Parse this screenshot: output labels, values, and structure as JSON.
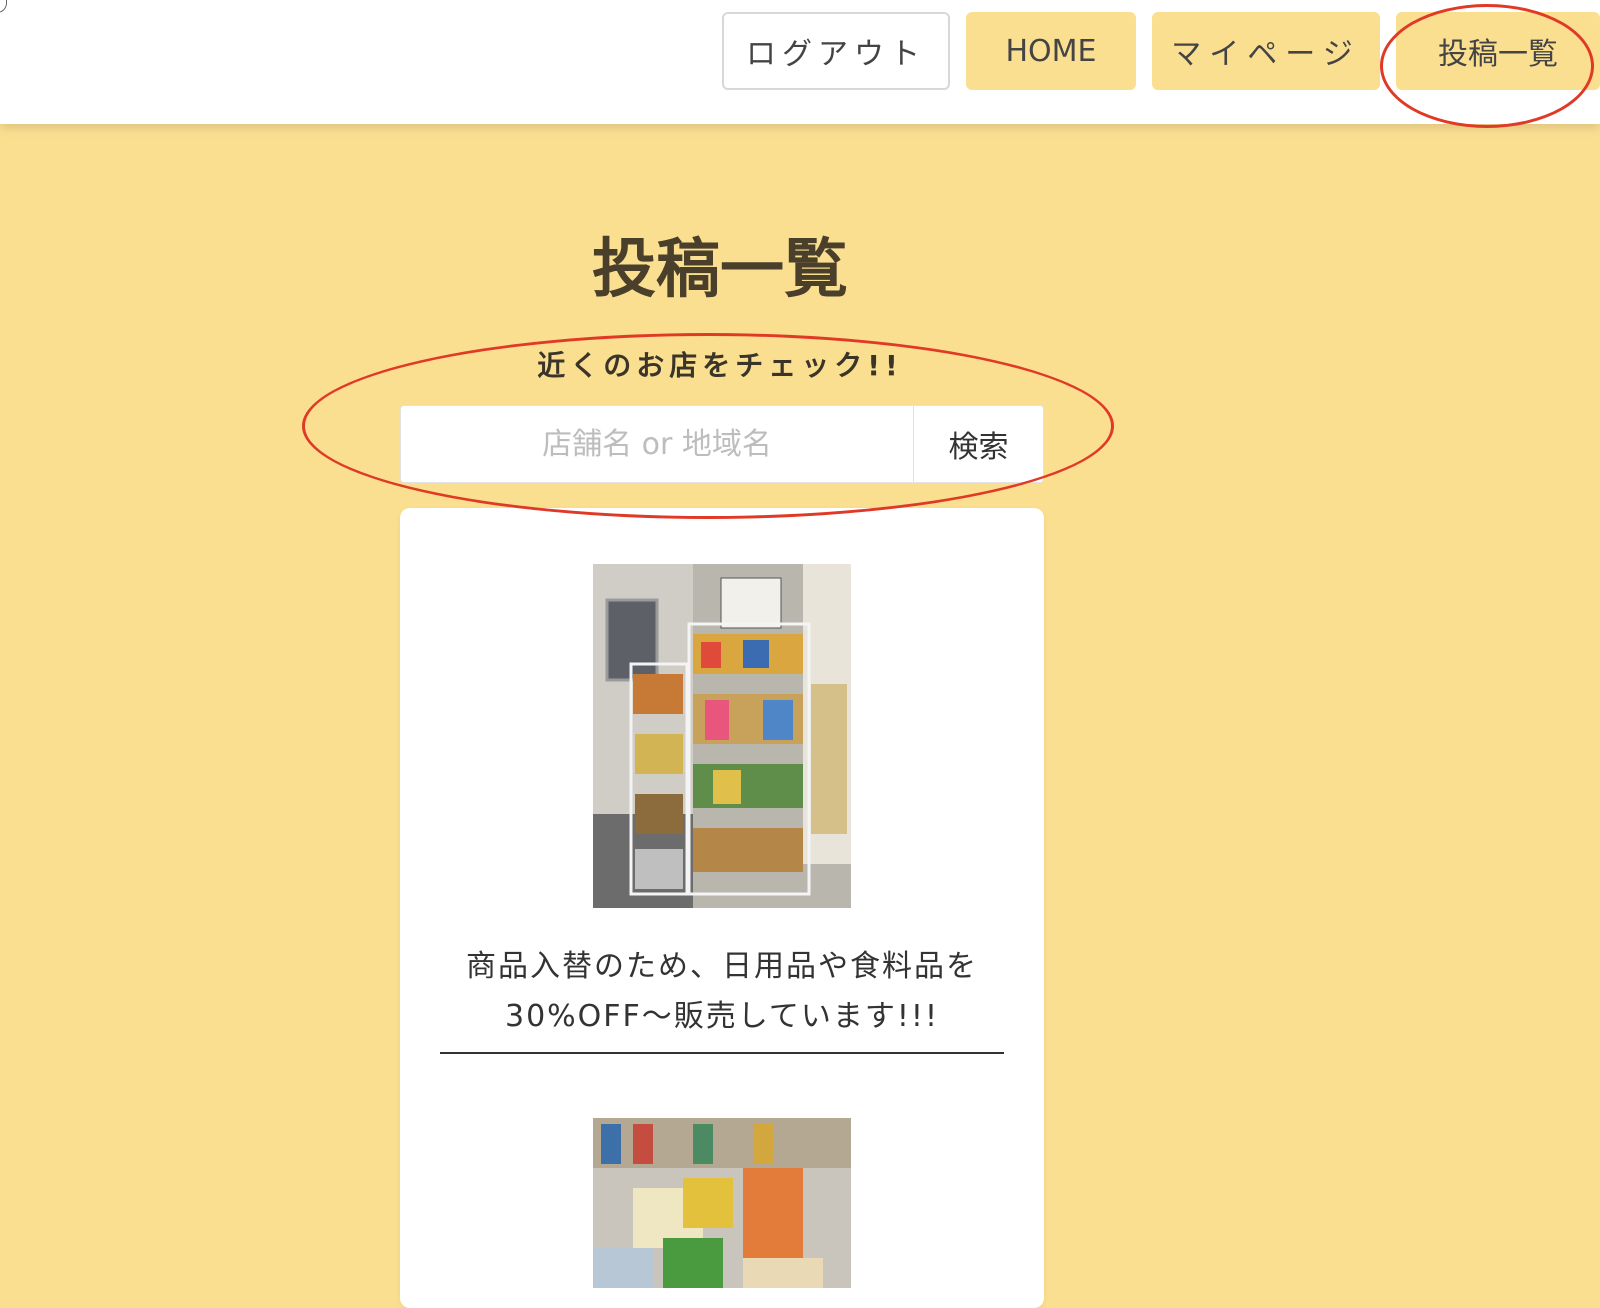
{
  "header": {
    "nav": {
      "logout": "ログアウト",
      "home": "HOME",
      "mypage": "マイページ",
      "posts": "投稿一覧"
    }
  },
  "main": {
    "title": "投稿一覧",
    "subtitle": "近くのお店をチェック!!",
    "search": {
      "placeholder": "店舗名 or 地域名",
      "button_label": "検索"
    },
    "posts": [
      {
        "text_line1": "商品入替のため、日用品や食料品を",
        "text_line2": "30%OFF〜販売しています!!!"
      }
    ]
  },
  "colors": {
    "background": "#fbdf91",
    "button_fill": "#fbdf91",
    "annotation": "#e03a27"
  }
}
